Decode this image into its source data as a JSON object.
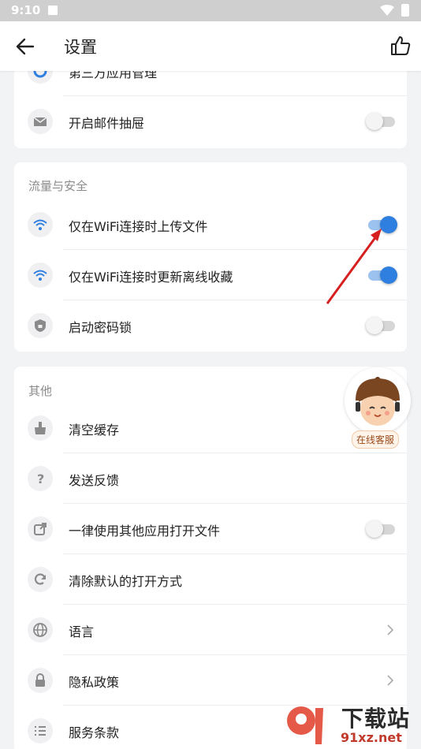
{
  "status_bar": {
    "time": "9:10"
  },
  "app_bar": {
    "title": "设置"
  },
  "card_top": {
    "items": [
      {
        "label": "第三方应用管理"
      },
      {
        "label": "开启邮件抽屉",
        "toggle_on": false
      }
    ]
  },
  "traffic_security": {
    "title": "流量与安全",
    "items": [
      {
        "label": "仅在WiFi连接时上传文件",
        "toggle_on": true
      },
      {
        "label": "仅在WiFi连接时更新离线收藏",
        "toggle_on": true
      },
      {
        "label": "启动密码锁",
        "toggle_on": false
      }
    ]
  },
  "other": {
    "title": "其他",
    "items": [
      {
        "label": "清空缓存"
      },
      {
        "label": "发送反馈"
      },
      {
        "label": "一律使用其他应用打开文件",
        "toggle_on": false
      },
      {
        "label": "清除默认的打开方式"
      },
      {
        "label": "语言"
      },
      {
        "label": "隐私政策"
      },
      {
        "label": "服务条款"
      }
    ]
  },
  "online_service": {
    "label": "在线客服"
  },
  "watermark": {
    "brand": "下载站",
    "site": "91xz.net"
  },
  "colors": {
    "accent": "#2f7fe0",
    "annotation_arrow": "#d62020"
  }
}
